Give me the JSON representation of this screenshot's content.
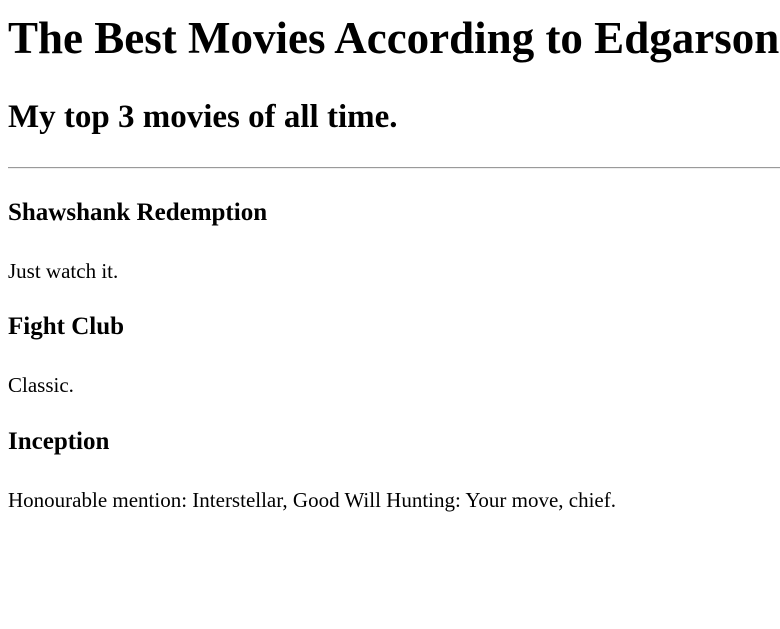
{
  "header": {
    "title": "The Best Movies According to Edgarson",
    "subtitle": "My top 3 movies of all time."
  },
  "movies": [
    {
      "title": "Shawshank Redemption",
      "note": "Just watch it."
    },
    {
      "title": "Fight Club",
      "note": "Classic."
    },
    {
      "title": "Inception"
    }
  ],
  "footer": {
    "mention": "Honourable mention: Interstellar, Good Will Hunting: Your move, chief."
  }
}
